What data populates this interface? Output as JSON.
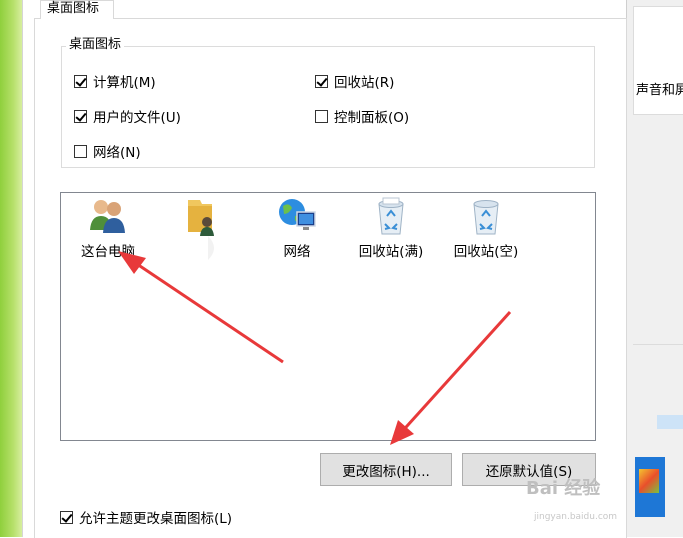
{
  "tab": {
    "label": "桌面图标"
  },
  "group": {
    "title": "桌面图标",
    "checkboxes": [
      {
        "label": "计算机(M)",
        "checked": true
      },
      {
        "label": "回收站(R)",
        "checked": true
      },
      {
        "label": "用户的文件(U)",
        "checked": true
      },
      {
        "label": "控制面板(O)",
        "checked": false
      },
      {
        "label": "网络(N)",
        "checked": false
      }
    ]
  },
  "icons": [
    {
      "label": "这台电脑",
      "icon": "users-icon"
    },
    {
      "label": "",
      "icon": "user-folder-icon"
    },
    {
      "label": "网络",
      "icon": "network-globe-icon"
    },
    {
      "label": "回收站(满)",
      "icon": "recycle-bin-full-icon"
    },
    {
      "label": "回收站(空)",
      "icon": "recycle-bin-empty-icon"
    }
  ],
  "buttons": {
    "change_icon": "更改图标(H)...",
    "restore_default": "还原默认值(S)"
  },
  "allow_theme": {
    "label": "允许主题更改桌面图标(L)",
    "checked": true
  },
  "side_panel": {
    "text": "声音和屏"
  },
  "watermark": {
    "text": "Bai 经验",
    "sub": "jingyan.baidu.com"
  },
  "colors": {
    "arrow": "#e8393a",
    "accent": "#1e77d6"
  }
}
